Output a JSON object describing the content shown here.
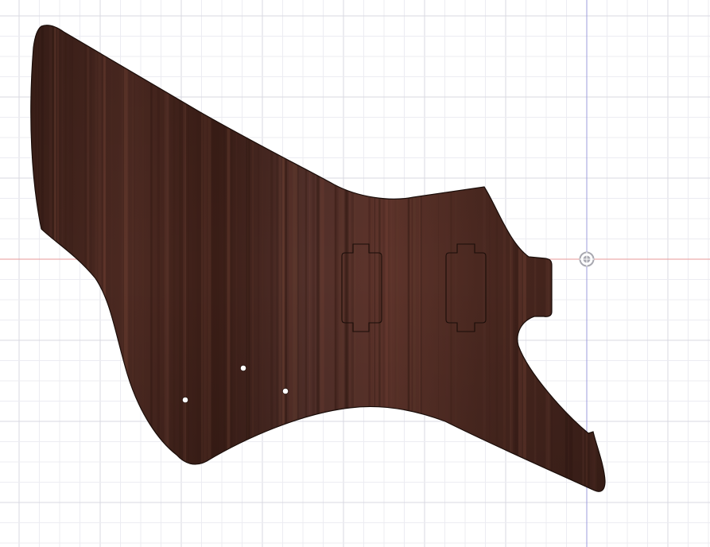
{
  "canvas": {
    "background": "#ffffff",
    "grid_minor_color": "#ececf2",
    "grid_major_color": "#d8d8e2",
    "axis_x_color": "#e79a9a",
    "axis_y_color": "#9c9cde"
  },
  "model": {
    "body_material": "rosewood",
    "body_color_dark": "#3a1e17",
    "body_color_mid": "#553027",
    "body_color_light": "#6e3f33",
    "outline_color": "#1a0d09",
    "pickup_count": 2,
    "control_hole_count": 3
  },
  "origin_marker": {
    "icon": "origin-target-icon",
    "color": "#a8a8b0"
  }
}
